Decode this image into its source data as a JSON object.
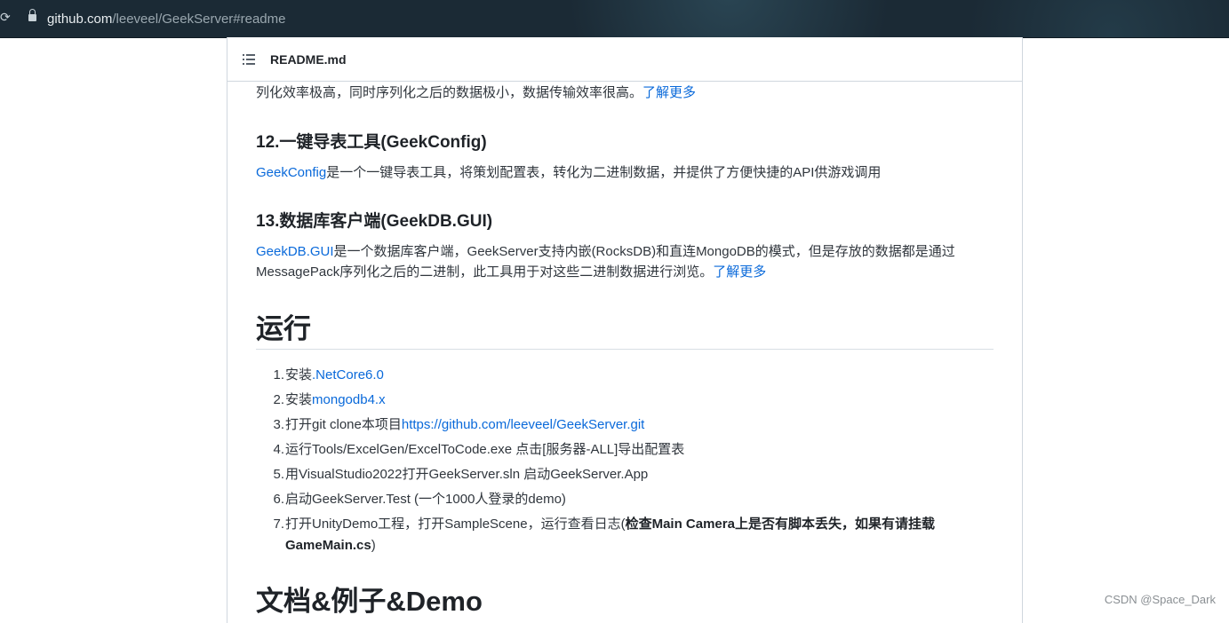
{
  "browser": {
    "url_host": "github.com",
    "url_path": "/leeveel/GeekServer#readme"
  },
  "readme": {
    "file_name": "README.md"
  },
  "content": {
    "intro_text": "列化效率极高，同时序列化之后的数据极小，数据传输效率很高。",
    "intro_link": "了解更多",
    "section12_title": "12.一键导表工具(GeekConfig)",
    "section12_link": "GeekConfig",
    "section12_text": "是一个一键导表工具，将策划配置表，转化为二进制数据，并提供了方便快捷的API供游戏调用",
    "section13_title": "13.数据库客户端(GeekDB.GUI)",
    "section13_link": "GeekDB.GUI",
    "section13_text1": "是一个数据库客户端，GeekServer支持内嵌(RocksDB)和直连MongoDB的模式，但是存放的数据都是通过",
    "section13_text2": "MessagePack序列化之后的二进制，此工具用于对这些二进制数据进行浏览。",
    "section13_more": "了解更多",
    "run_heading": "运行",
    "steps": [
      {
        "num": "1.",
        "pre": "安装",
        "link": ".NetCore6.0"
      },
      {
        "num": "2.",
        "pre": "安装",
        "link": "mongodb4.x"
      },
      {
        "num": "3.",
        "pre": "打开git clone本项目",
        "link": "https://github.com/leeveel/GeekServer.git"
      },
      {
        "num": "4.",
        "text": "运行Tools/ExcelGen/ExcelToCode.exe 点击[服务器-ALL]导出配置表"
      },
      {
        "num": "5.",
        "text": "用VisualStudio2022打开GeekServer.sln 启动GeekServer.App"
      },
      {
        "num": "6.",
        "text": "启动GeekServer.Test (一个1000人登录的demo)"
      },
      {
        "num": "7.",
        "pre": "打开UnityDemo工程，打开SampleScene，运行查看日志(",
        "bold": "检查Main Camera上是否有脚本丢失，如果有请挂载",
        "bold2": "GameMain.cs",
        "post": ")"
      }
    ],
    "docs_heading": "文档&例子&Demo"
  },
  "watermark": "CSDN @Space_Dark"
}
